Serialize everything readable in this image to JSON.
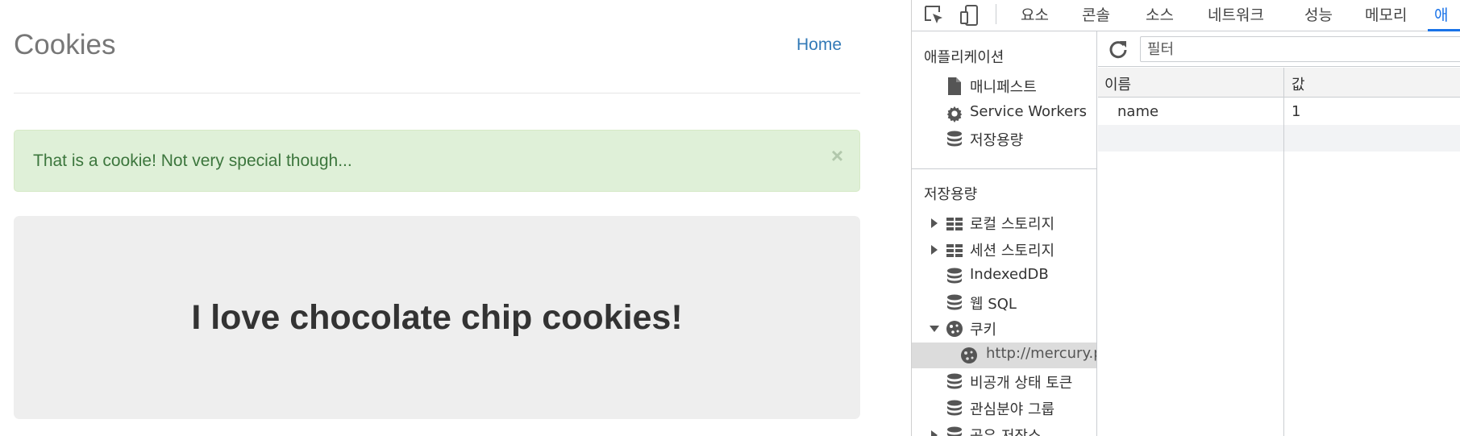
{
  "webpage": {
    "brand": "Cookies",
    "nav_home": "Home",
    "alert_text": "That is a cookie! Not very special though...",
    "alert_close": "×",
    "jumbotron_title": "I love chocolate chip cookies!"
  },
  "devtools": {
    "tabs": [
      "요소",
      "콘솔",
      "소스",
      "네트워크",
      "성능",
      "메모리",
      "애"
    ],
    "active_tab_index": 6,
    "toolbar_icons": [
      "inspect-element-icon",
      "device-toggle-icon"
    ],
    "sidebar": {
      "application_section_title": "애플리케이션",
      "application_items": [
        {
          "label": "매니페스트",
          "icon": "file-icon"
        },
        {
          "label": "Service Workers",
          "icon": "gear-icon"
        },
        {
          "label": "저장용량",
          "icon": "database-icon"
        }
      ],
      "storage_section_title": "저장용량",
      "storage_items": [
        {
          "label": "로컬 스토리지",
          "icon": "table-icon",
          "arrow": "right"
        },
        {
          "label": "세션 스토리지",
          "icon": "table-icon",
          "arrow": "right"
        },
        {
          "label": "IndexedDB",
          "icon": "database-icon",
          "arrow": ""
        },
        {
          "label": "웹 SQL",
          "icon": "database-icon",
          "arrow": ""
        },
        {
          "label": "쿠키",
          "icon": "cookie-icon",
          "arrow": "down"
        },
        {
          "label": "http://mercury.p",
          "icon": "cookie-icon",
          "arrow": "",
          "child": true,
          "selected": true
        },
        {
          "label": "비공개 상태 토큰",
          "icon": "database-icon",
          "arrow": ""
        },
        {
          "label": "관심분야 그룹",
          "icon": "database-icon",
          "arrow": ""
        },
        {
          "label": "공유 저장소",
          "icon": "database-icon",
          "arrow": "right"
        }
      ]
    },
    "main": {
      "filter_placeholder": "필터",
      "columns": [
        "이름",
        "값"
      ],
      "rows": [
        {
          "name": "name",
          "value": "1"
        }
      ]
    },
    "accent_color": "#1a73e8"
  }
}
